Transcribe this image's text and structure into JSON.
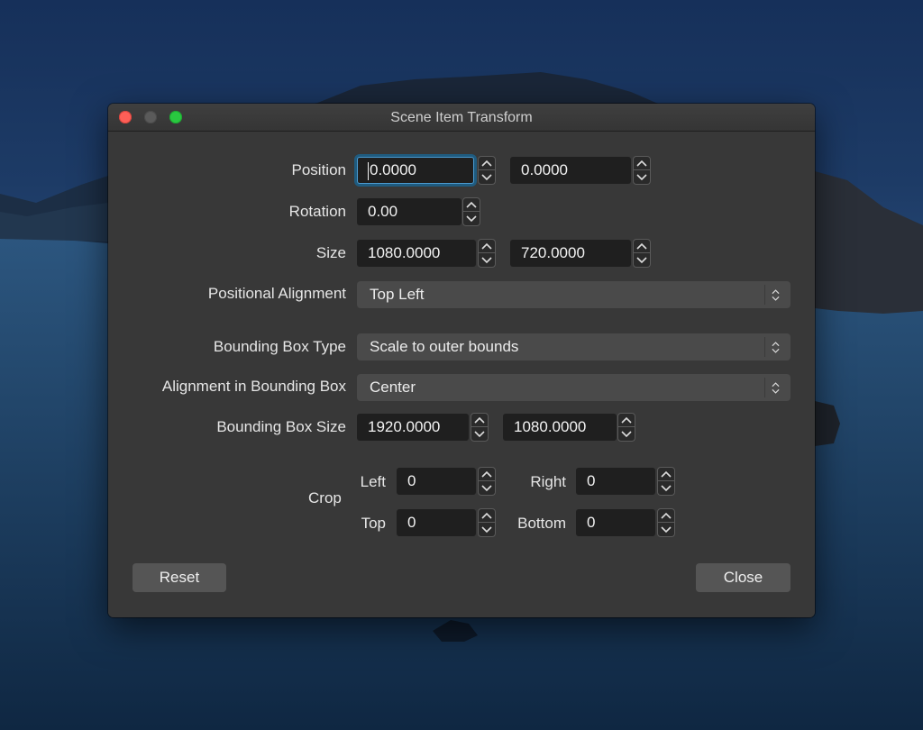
{
  "window": {
    "title": "Scene Item Transform"
  },
  "position": {
    "label": "Position",
    "x": "0.0000",
    "y": "0.0000"
  },
  "rotation": {
    "label": "Rotation",
    "value": "0.00"
  },
  "size": {
    "label": "Size",
    "width": "1080.0000",
    "height": "720.0000"
  },
  "positional_alignment": {
    "label": "Positional Alignment",
    "selected": "Top Left"
  },
  "bounding_box_type": {
    "label": "Bounding Box Type",
    "selected": "Scale to outer bounds"
  },
  "alignment_in_bounding_box": {
    "label": "Alignment in Bounding Box",
    "selected": "Center"
  },
  "bounding_box_size": {
    "label": "Bounding Box Size",
    "width": "1920.0000",
    "height": "1080.0000"
  },
  "crop": {
    "label": "Crop",
    "left_label": "Left",
    "left": "0",
    "right_label": "Right",
    "right": "0",
    "top_label": "Top",
    "top": "0",
    "bottom_label": "Bottom",
    "bottom": "0"
  },
  "buttons": {
    "reset": "Reset",
    "close": "Close"
  },
  "colors": {
    "window_bg": "#383838",
    "field_bg": "#1f1f1f",
    "focus_ring": "#1f5b7f",
    "traffic_close": "#fe5f57",
    "traffic_zoom": "#29c840"
  }
}
